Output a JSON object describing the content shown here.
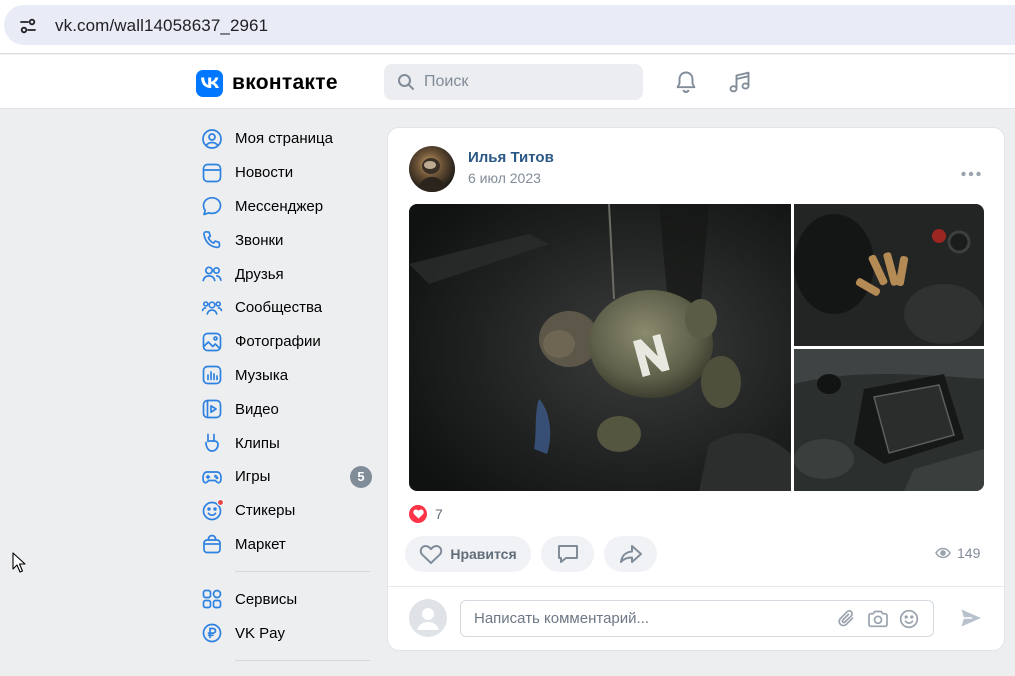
{
  "browser": {
    "url": "vk.com/wall14058637_2961"
  },
  "header": {
    "logo_text": "вконтакте",
    "search_placeholder": "Поиск"
  },
  "nav": {
    "items": [
      {
        "label": "Моя страница",
        "icon": "profile-icon"
      },
      {
        "label": "Новости",
        "icon": "news-icon"
      },
      {
        "label": "Мессенджер",
        "icon": "messenger-icon"
      },
      {
        "label": "Звонки",
        "icon": "phone-icon"
      },
      {
        "label": "Друзья",
        "icon": "friends-icon"
      },
      {
        "label": "Сообщества",
        "icon": "communities-icon"
      },
      {
        "label": "Фотографии",
        "icon": "photos-icon"
      },
      {
        "label": "Музыка",
        "icon": "music-icon"
      },
      {
        "label": "Видео",
        "icon": "video-icon"
      },
      {
        "label": "Клипы",
        "icon": "clips-icon"
      },
      {
        "label": "Игры",
        "icon": "games-icon",
        "badge": "5"
      },
      {
        "label": "Стикеры",
        "icon": "stickers-icon"
      },
      {
        "label": "Маркет",
        "icon": "market-icon"
      }
    ],
    "extra": [
      {
        "label": "Сервисы",
        "icon": "services-icon"
      },
      {
        "label": "VK Pay",
        "icon": "vkpay-icon"
      }
    ]
  },
  "post": {
    "author": "Илья Титов",
    "date": "6 июл 2023",
    "reactions_count": "7",
    "like_label": "Нравится",
    "views_count": "149",
    "comment_placeholder": "Написать комментарий..."
  },
  "colors": {
    "accent": "#0077ff",
    "link": "#2a5885",
    "muted": "#818c99",
    "reaction": "#ff3347"
  }
}
